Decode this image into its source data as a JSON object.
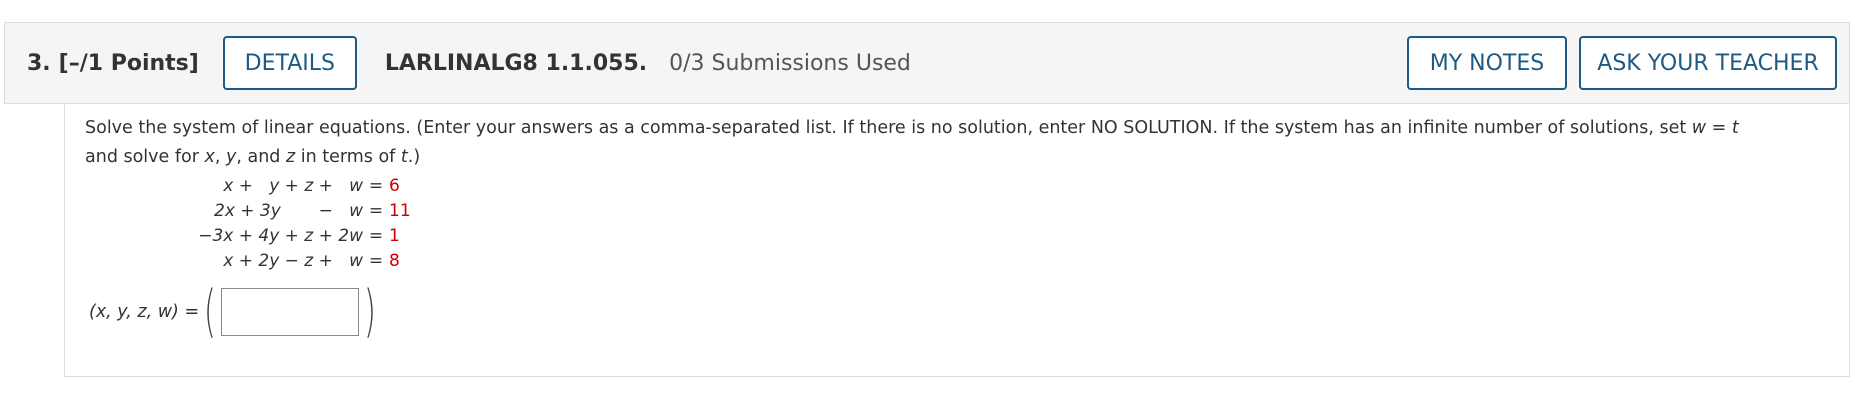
{
  "question": {
    "number": "3.",
    "points": "[–/1 Points]",
    "details_label": "DETAILS",
    "id": "LARLINALG8 1.1.055.",
    "submissions": "0/3 Submissions Used",
    "my_notes_label": "MY NOTES",
    "ask_teacher_label": "ASK YOUR TEACHER"
  },
  "instructions": {
    "part1": "Solve the system of linear equations. (Enter your answers as a comma-separated list. If there is no solution, enter NO SOLUTION. If the system has an infinite number of solutions, set ",
    "set_expr": "w = t",
    "part2": " and solve for ",
    "var_x": "x",
    "sep1": ", ",
    "var_y": "y",
    "sep2": ", and ",
    "var_z": "z",
    "part3": " in terms of ",
    "var_t": "t",
    "part4": ".)"
  },
  "equations": [
    {
      "lhs": "x +   y + z +   w",
      "eq": "=",
      "rhs": "6"
    },
    {
      "lhs": "2x + 3y       −   w",
      "eq": "=",
      "rhs": "11"
    },
    {
      "lhs": "−3x + 4y + z + 2w",
      "eq": "=",
      "rhs": "1"
    },
    {
      "lhs": "x + 2y − z +   w",
      "eq": "=",
      "rhs": "8"
    }
  ],
  "answer": {
    "label": "(x, y, z, w) =",
    "open_paren": "(",
    "close_paren": ")",
    "value": ""
  }
}
